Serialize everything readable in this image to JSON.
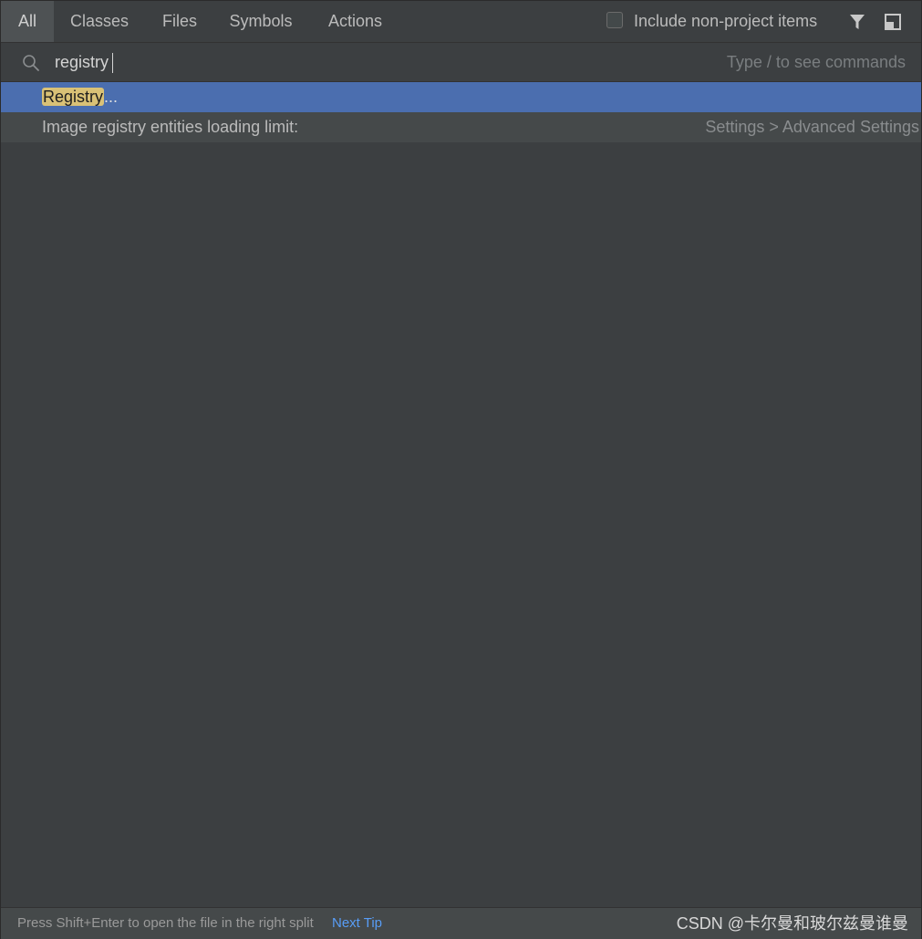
{
  "tabs": [
    {
      "label": "All",
      "active": true
    },
    {
      "label": "Classes",
      "active": false
    },
    {
      "label": "Files",
      "active": false
    },
    {
      "label": "Symbols",
      "active": false
    },
    {
      "label": "Actions",
      "active": false
    }
  ],
  "toolbar": {
    "include_non_project_label": "Include non-project items",
    "include_non_project_checked": false,
    "filter_icon": "filter-icon",
    "preview_icon": "preview-panel-icon"
  },
  "search": {
    "icon": "search-icon",
    "value": "registry",
    "hint": "Type / to see commands"
  },
  "results": [
    {
      "match": "Registry",
      "suffix": "...",
      "location": "",
      "selected": true
    },
    {
      "label": "Image registry entities loading limit:",
      "location": "Settings > Advanced Settings",
      "selected": false
    }
  ],
  "footer": {
    "tip": "Press Shift+Enter to open the file in the right split",
    "next_tip": "Next Tip"
  },
  "watermark": "CSDN @卡尔曼和玻尔兹曼谁曼",
  "colors": {
    "background": "#3c3f41",
    "selection": "#4b6eaf",
    "match_highlight": "#d9c176",
    "link": "#589df6"
  }
}
